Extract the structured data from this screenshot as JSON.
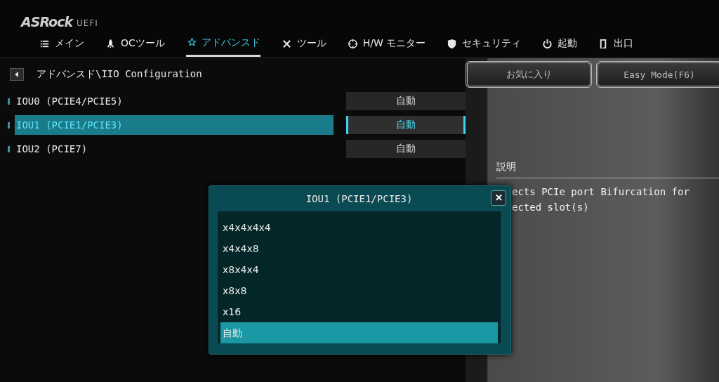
{
  "brand": {
    "logo": "ASRock",
    "suffix": "UEFI"
  },
  "tabs": [
    {
      "label": "メイン",
      "selected": false
    },
    {
      "label": "OCツール",
      "selected": false
    },
    {
      "label": "アドバンスド",
      "selected": true
    },
    {
      "label": "ツール",
      "selected": false
    },
    {
      "label": "H/W モニター",
      "selected": false
    },
    {
      "label": "セキュリティ",
      "selected": false
    },
    {
      "label": "起動",
      "selected": false
    },
    {
      "label": "出口",
      "selected": false
    }
  ],
  "breadcrumb": "アドバンスド\\IIO Configuration",
  "buttons": [
    "お気に入り",
    "Easy Mode(F6)"
  ],
  "settings": [
    {
      "label": "IOU0 (PCIE4/PCIE5)",
      "value": "自動",
      "selected": false
    },
    {
      "label": "IOU1 (PCIE1/PCIE3)",
      "value": "自動",
      "selected": true
    },
    {
      "label": "IOU2 (PCIE7)",
      "value": "自動",
      "selected": false
    }
  ],
  "description": {
    "title": "説明",
    "lines": [
      "ects PCIe port Bifurcation for",
      "ected slot(s)"
    ]
  },
  "popup": {
    "title": "IOU1 (PCIE1/PCIE3)",
    "close": "✕",
    "options": [
      {
        "label": "x4x4x4x4",
        "selected": false
      },
      {
        "label": "x4x4x8",
        "selected": false
      },
      {
        "label": "x8x4x4",
        "selected": false
      },
      {
        "label": "x8x8",
        "selected": false
      },
      {
        "label": "x16",
        "selected": false
      },
      {
        "label": "自動",
        "selected": true
      }
    ]
  }
}
